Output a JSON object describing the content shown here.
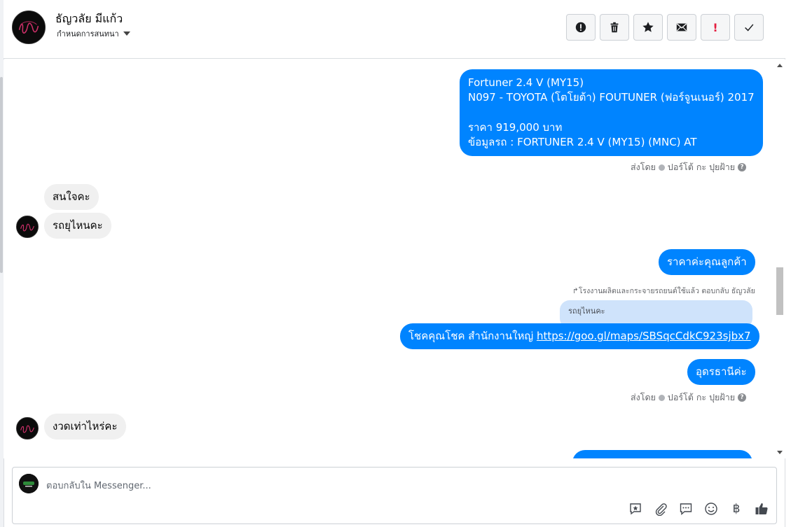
{
  "header": {
    "contact_name": "ธัญวลัย มีแก้ว",
    "conversation_settings": "กำหนดการสนทนา"
  },
  "actions": [
    {
      "name": "mark-spam-button",
      "icon": "alert-circle-icon"
    },
    {
      "name": "delete-button",
      "icon": "trash-icon"
    },
    {
      "name": "star-button",
      "icon": "star-icon"
    },
    {
      "name": "mark-unread-button",
      "icon": "envelope-icon"
    },
    {
      "name": "important-button",
      "icon": "exclamation-icon",
      "glyph": "!"
    },
    {
      "name": "done-button",
      "icon": "check-icon"
    }
  ],
  "messages": {
    "car_info": {
      "line1": "Fortuner 2.4 V (MY15)",
      "line2": "N097 - TOYOTA (โตโยต้า) FOUTUNER (ฟอร์จูนเนอร์) 2017",
      "line3": "ราคา 919,000 บาท",
      "line4": "ข้อมูลรถ : FORTUNER 2.4 V (MY15) (MNC) AT"
    },
    "sent_by_1": {
      "prefix": "ส่งโดย",
      "sender": "ปอร์โต้ กะ ปุยฝ้าย",
      "help": "?"
    },
    "in_1": "สนใจคะ",
    "in_2": "รถยุไหนคะ",
    "out_price": "ราคาค่ะคุณลูกค้า",
    "reply_note": "โรงงานผลิตและกระจายรถยนต์ใช้แล้ว ตอบกลับ ธัญวลัย",
    "quoted": "รถยุไหนคะ",
    "out_location_text": "โชคคุณโชค สำนักงานใหญ่ ",
    "out_location_link": "https://goo.gl/maps/SBSqcCdkC923sjbx7",
    "out_udon": "อุดรธานีค่ะ",
    "sent_by_2": {
      "prefix": "ส่งโดย",
      "sender": "ปอร์โต้ กะ ปุยฝ้าย",
      "help": "?"
    },
    "in_3": "งวดเท่าไหร่คะ"
  },
  "composer": {
    "placeholder": "ตอบกลับใน Messenger...",
    "tools": [
      "saved-reply-icon",
      "attachment-icon",
      "chat-bubble-icon",
      "emoji-icon",
      "baht-icon",
      "thumbs-up-icon"
    ],
    "baht_glyph": "฿"
  },
  "colors": {
    "outgoing_bubble": "#0084ff",
    "incoming_bubble": "#f0f0f0",
    "quote_bubble": "#cfe3fb"
  }
}
